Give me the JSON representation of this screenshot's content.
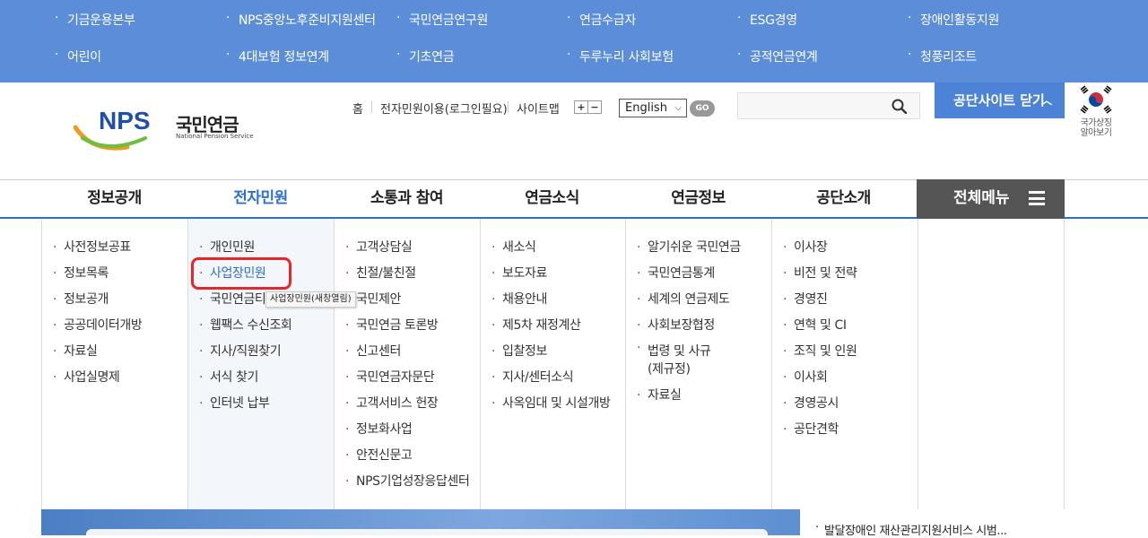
{
  "related_sites": {
    "row1": [
      "기금운용본부",
      "NPS중앙노후준비지원센터",
      "국민연금연구원",
      "연금수급자",
      "ESG경영",
      "장애인활동지원"
    ],
    "row2": [
      "어린이",
      "4대보험 정보연계",
      "기초연금",
      "두루누리 사회보험",
      "공적연금연계",
      "청풍리조트"
    ]
  },
  "logo": {
    "mark": "NPS",
    "korean": "국민연금",
    "english": "National Pension Service"
  },
  "util_links": {
    "home": "홈",
    "e_service": "전자민원이용(로그인필요)",
    "sitemap": "사이트맵",
    "zoom_in": "+",
    "zoom_out": "−"
  },
  "language": {
    "selected": "English",
    "go": "GO"
  },
  "search": {
    "placeholder": ""
  },
  "close_related": {
    "label": "공단사이트 닫기"
  },
  "national_symbol": {
    "line1": "국가상징",
    "line2": "알아보기"
  },
  "gnb": {
    "items": [
      "정보공개",
      "전자민원",
      "소통과 참여",
      "연금소식",
      "연금정보",
      "공단소개"
    ],
    "active": "전자민원",
    "all_menu": "전체메뉴"
  },
  "submenu": {
    "col1": [
      "사전정보공표",
      "정보목록",
      "정보공개",
      "공공데이터개방",
      "자료실",
      "사업실명제"
    ],
    "col2": [
      "개인민원",
      "사업장민원",
      "국민연금티",
      "웹팩스 수신조회",
      "지사/직원찾기",
      "서식 찾기",
      "인터넷 납부"
    ],
    "col3": [
      "고객상담실",
      "친절/불친절",
      "국민제안",
      "국민연금 토론방",
      "신고센터",
      "국민연금자문단",
      "고객서비스 헌장",
      "정보화사업",
      "안전신문고",
      "NPS기업성장응답센터"
    ],
    "col4": [
      "새소식",
      "보도자료",
      "채용안내",
      "제5차 재정계산",
      "입찰정보",
      "지사/센터소식",
      "사옥임대 및 시설개방"
    ],
    "col5": [
      "알기쉬운 국민연금",
      "국민연금통계",
      "세계의 연금제도",
      "사회보장협정",
      "법령 및 사규(제규정)",
      "자료실"
    ],
    "col6": [
      "이사장",
      "비전 및 전략",
      "경영진",
      "연혁 및 CI",
      "조직 및 인원",
      "이사회",
      "경영공시",
      "공단견학"
    ]
  },
  "tooltip": "사업장민원(새창열림)",
  "notice": {
    "item": "발달장애인 재산관리지원서비스 시범..."
  },
  "colors": {
    "related_bg": "#5b8dd9",
    "close_btn": "#4d83d6",
    "accent": "#2d6fcf",
    "all_menu_bg": "#555555",
    "highlight": "#e8262a"
  }
}
